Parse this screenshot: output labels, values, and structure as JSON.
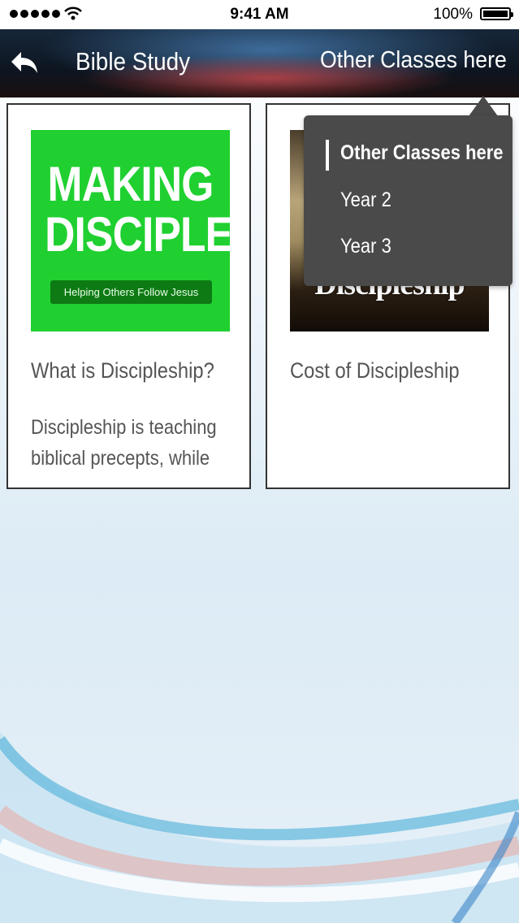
{
  "status_bar": {
    "time": "9:41 AM",
    "battery": "100%"
  },
  "nav": {
    "title": "Bible Study",
    "menu_label": "Other Classes here"
  },
  "cards": [
    {
      "image": {
        "line1": "MAKING",
        "line2": "DISCIPLES",
        "banner": "Helping Others Follow Jesus"
      },
      "title": "What is Discipleship?",
      "description": "Discipleship is teaching biblical precepts, while"
    },
    {
      "image": {
        "caption": "Discipleship"
      },
      "title": "Cost of Discipleship"
    }
  ],
  "dropdown": {
    "items": [
      "Other Classes here",
      "Year 2",
      "Year 3"
    ],
    "selected": "Other Classes here"
  },
  "colors": {
    "nav_background": "#0d1520",
    "popover_background": "#4a4a4a",
    "thumb_green": "#20d031",
    "card_text": "#555555"
  },
  "icons": {
    "back": "back-arrow-icon",
    "wifi": "wifi-icon",
    "battery": "battery-icon",
    "signal": "signal-icon"
  }
}
